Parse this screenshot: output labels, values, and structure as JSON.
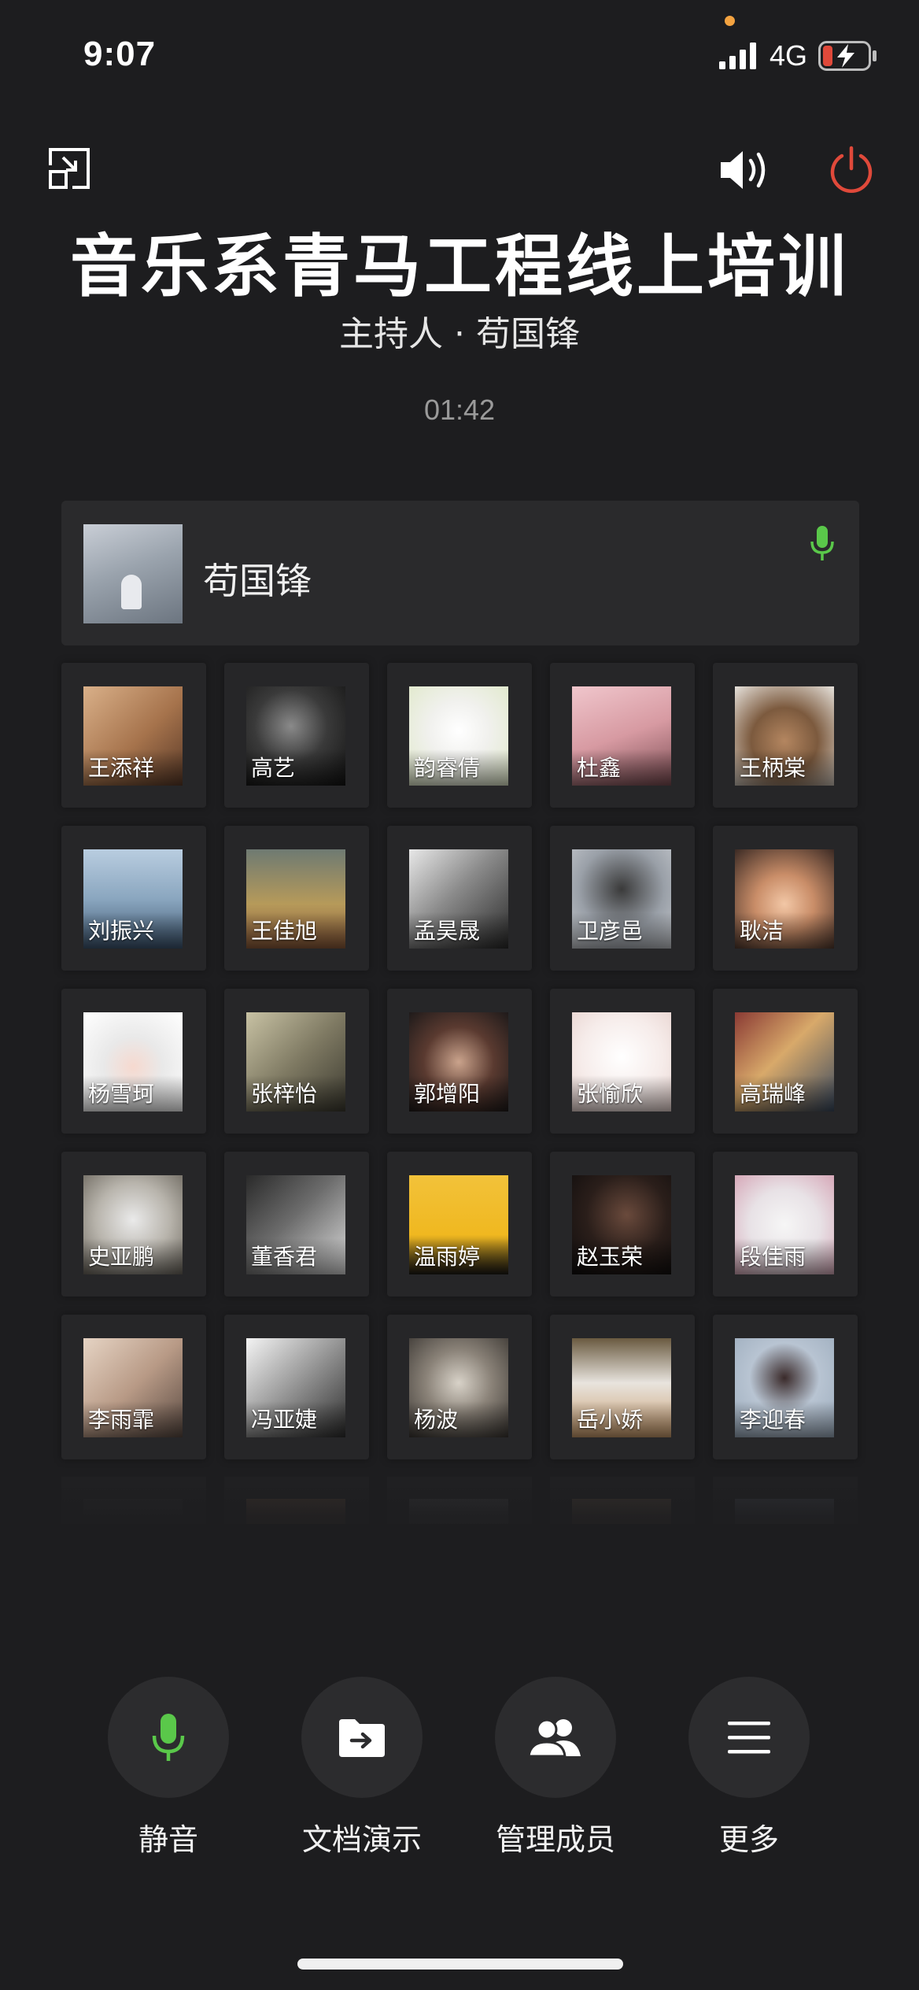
{
  "status_bar": {
    "time": "9:07",
    "network": "4G"
  },
  "meeting": {
    "title": "音乐系青马工程线上培训",
    "host_line": "主持人 · 苟国锋",
    "duration": "01:42"
  },
  "host_card": {
    "name": "苟国锋"
  },
  "participants": [
    {
      "name": "王添祥"
    },
    {
      "name": "高艺"
    },
    {
      "name": "韵睿倩"
    },
    {
      "name": "杜鑫"
    },
    {
      "name": "王柄棠"
    },
    {
      "name": "刘振兴"
    },
    {
      "name": "王佳旭"
    },
    {
      "name": "孟昊晟"
    },
    {
      "name": "卫彦邑"
    },
    {
      "name": "耿洁"
    },
    {
      "name": "杨雪珂"
    },
    {
      "name": "张梓怡"
    },
    {
      "name": "郭增阳"
    },
    {
      "name": "张愉欣"
    },
    {
      "name": "高瑞峰"
    },
    {
      "name": "史亚鹏"
    },
    {
      "name": "董香君"
    },
    {
      "name": "温雨婷"
    },
    {
      "name": "赵玉荣"
    },
    {
      "name": "段佳雨"
    },
    {
      "name": "李雨霏"
    },
    {
      "name": "冯亚婕"
    },
    {
      "name": "杨波"
    },
    {
      "name": "岳小娇"
    },
    {
      "name": "李迎春"
    }
  ],
  "toolbar": {
    "mute_label": "静音",
    "docs_label": "文档演示",
    "members_label": "管理成员",
    "more_label": "更多"
  },
  "colors": {
    "mic_active": "#5ac84a",
    "power": "#e0493a",
    "notification_dot": "#f4a340",
    "battery_low": "#e0493a"
  }
}
